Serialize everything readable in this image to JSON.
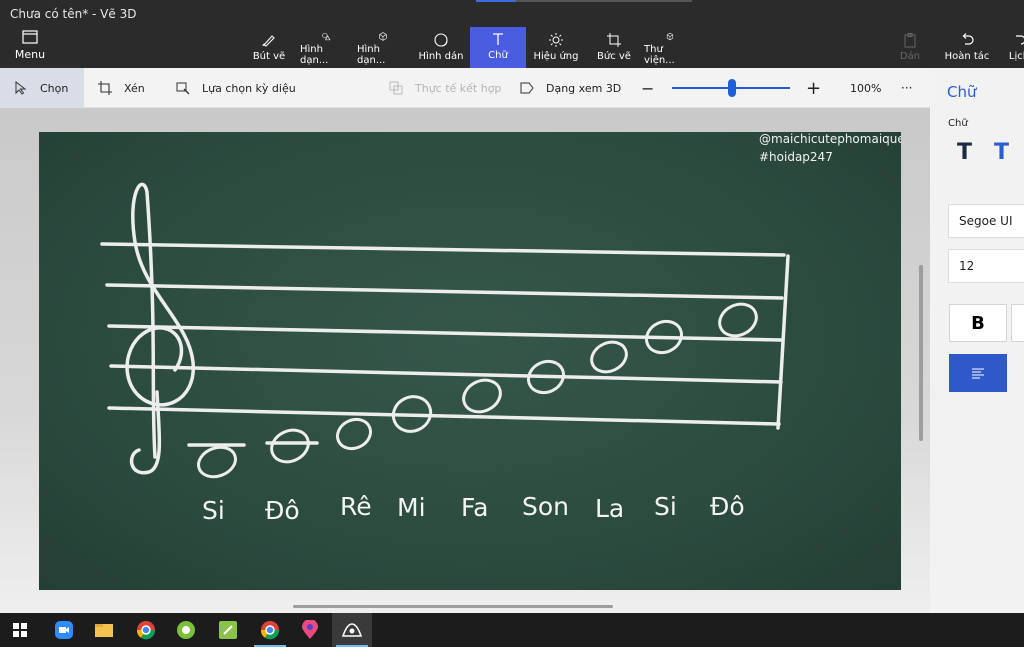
{
  "window": {
    "title": "Chưa có tên* - Vẽ 3D"
  },
  "top": {
    "menu": "Menu",
    "tools": [
      {
        "label": "Bút vẽ",
        "icon": "brush-icon"
      },
      {
        "label": "Hình dạn...",
        "icon": "2d-shapes-icon"
      },
      {
        "label": "Hình dạn...",
        "icon": "3d-shapes-icon"
      },
      {
        "label": "Hình dán",
        "icon": "stickers-icon"
      },
      {
        "label": "Chữ",
        "icon": "text-icon"
      },
      {
        "label": "Hiệu ứng",
        "icon": "effects-icon"
      },
      {
        "label": "Bức vẽ",
        "icon": "canvas-icon"
      },
      {
        "label": "Thư viện...",
        "icon": "library-icon"
      }
    ],
    "paste": "Dán",
    "undo": "Hoàn tác",
    "history": "Lịch"
  },
  "toolbar": {
    "select": "Chọn",
    "crop": "Xén",
    "magic_select": "Lựa chọn kỳ diệu",
    "mixed_reality": "Thực tế kết hợp",
    "view_3d": "Dạng xem 3D",
    "zoom_percent": "100%",
    "zoom_level": 0.48,
    "more": "···"
  },
  "canvas": {
    "watermark1": "@maichicutephomaique",
    "watermark2": "#hoidap247",
    "notes": [
      "Si",
      "Đô",
      "Rê",
      "Mi",
      "Fa",
      "Son",
      "La",
      "Si",
      "Đô"
    ]
  },
  "panel": {
    "title": "Chữ",
    "subtitle": "Chữ",
    "font": "Segoe UI",
    "size": "12",
    "bold": "B"
  },
  "colors": {
    "accent": "#4a5de0",
    "board": "#2f4f43",
    "chalk": "#f0f0f0"
  }
}
